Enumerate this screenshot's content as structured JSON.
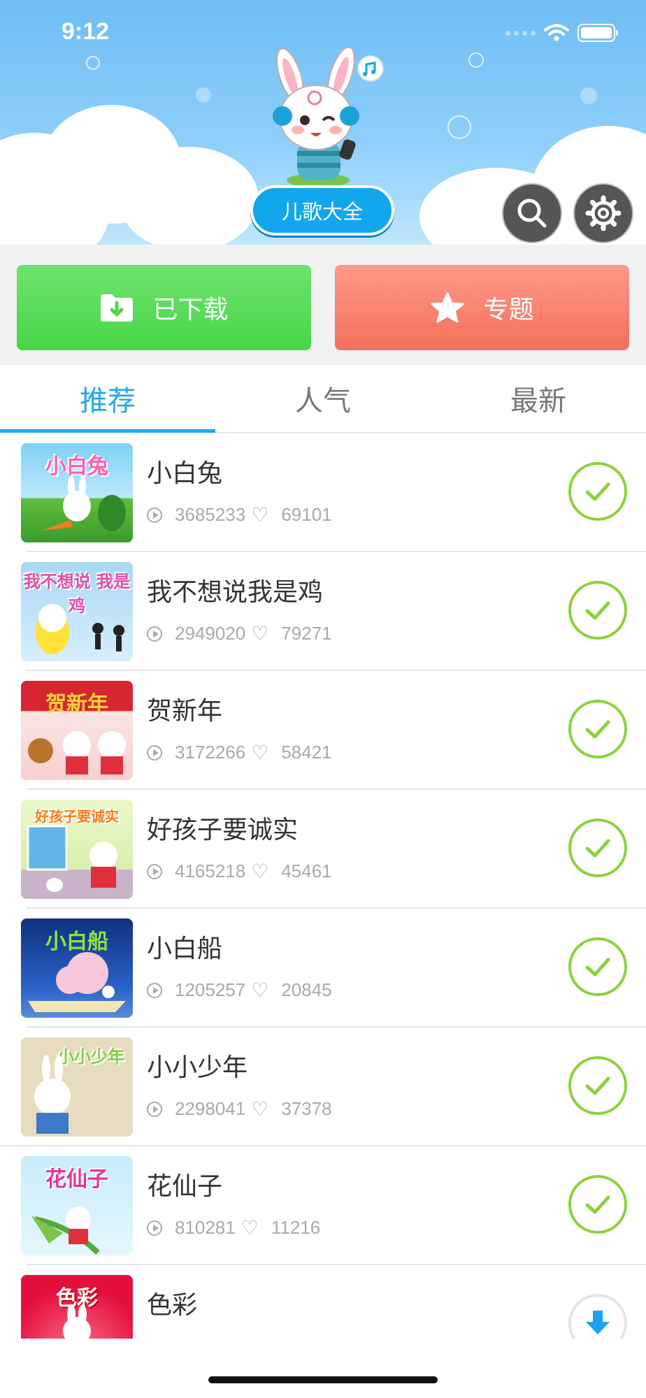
{
  "status_bar": {
    "time": "9:12"
  },
  "header": {
    "app_title": "儿歌大全"
  },
  "tiles": {
    "downloaded_label": "已下载",
    "topics_label": "专题"
  },
  "tabs": [
    {
      "label": "推荐",
      "active": true
    },
    {
      "label": "人气",
      "active": false
    },
    {
      "label": "最新",
      "active": false
    }
  ],
  "songs": [
    {
      "title": "小白兔",
      "plays": "3685233",
      "likes": "69101",
      "thumb_text": "小白兔",
      "state": "downloaded"
    },
    {
      "title": "我不想说我是鸡",
      "plays": "2949020",
      "likes": "79271",
      "thumb_text": "我不想说 我是鸡",
      "state": "downloaded"
    },
    {
      "title": "贺新年",
      "plays": "3172266",
      "likes": "58421",
      "thumb_text": "贺新年",
      "state": "downloaded"
    },
    {
      "title": "好孩子要诚实",
      "plays": "4165218",
      "likes": "45461",
      "thumb_text": "好孩子要诚实",
      "state": "downloaded"
    },
    {
      "title": "小白船",
      "plays": "1205257",
      "likes": "20845",
      "thumb_text": "小白船",
      "state": "downloaded"
    },
    {
      "title": "小小少年",
      "plays": "2298041",
      "likes": "37378",
      "thumb_text": "小小少年",
      "state": "downloaded"
    },
    {
      "title": "花仙子",
      "plays": "810281",
      "likes": "11216",
      "thumb_text": "花仙子",
      "state": "downloaded"
    },
    {
      "title": "色彩",
      "plays": "",
      "likes": "",
      "thumb_text": "色彩",
      "state": "download"
    }
  ],
  "colors": {
    "accent": "#21a7ef",
    "downloaded_tile": "#55d955",
    "topics_tile": "#f8826f",
    "check_green": "#8ed03c",
    "download_blue": "#1aa3ee"
  }
}
